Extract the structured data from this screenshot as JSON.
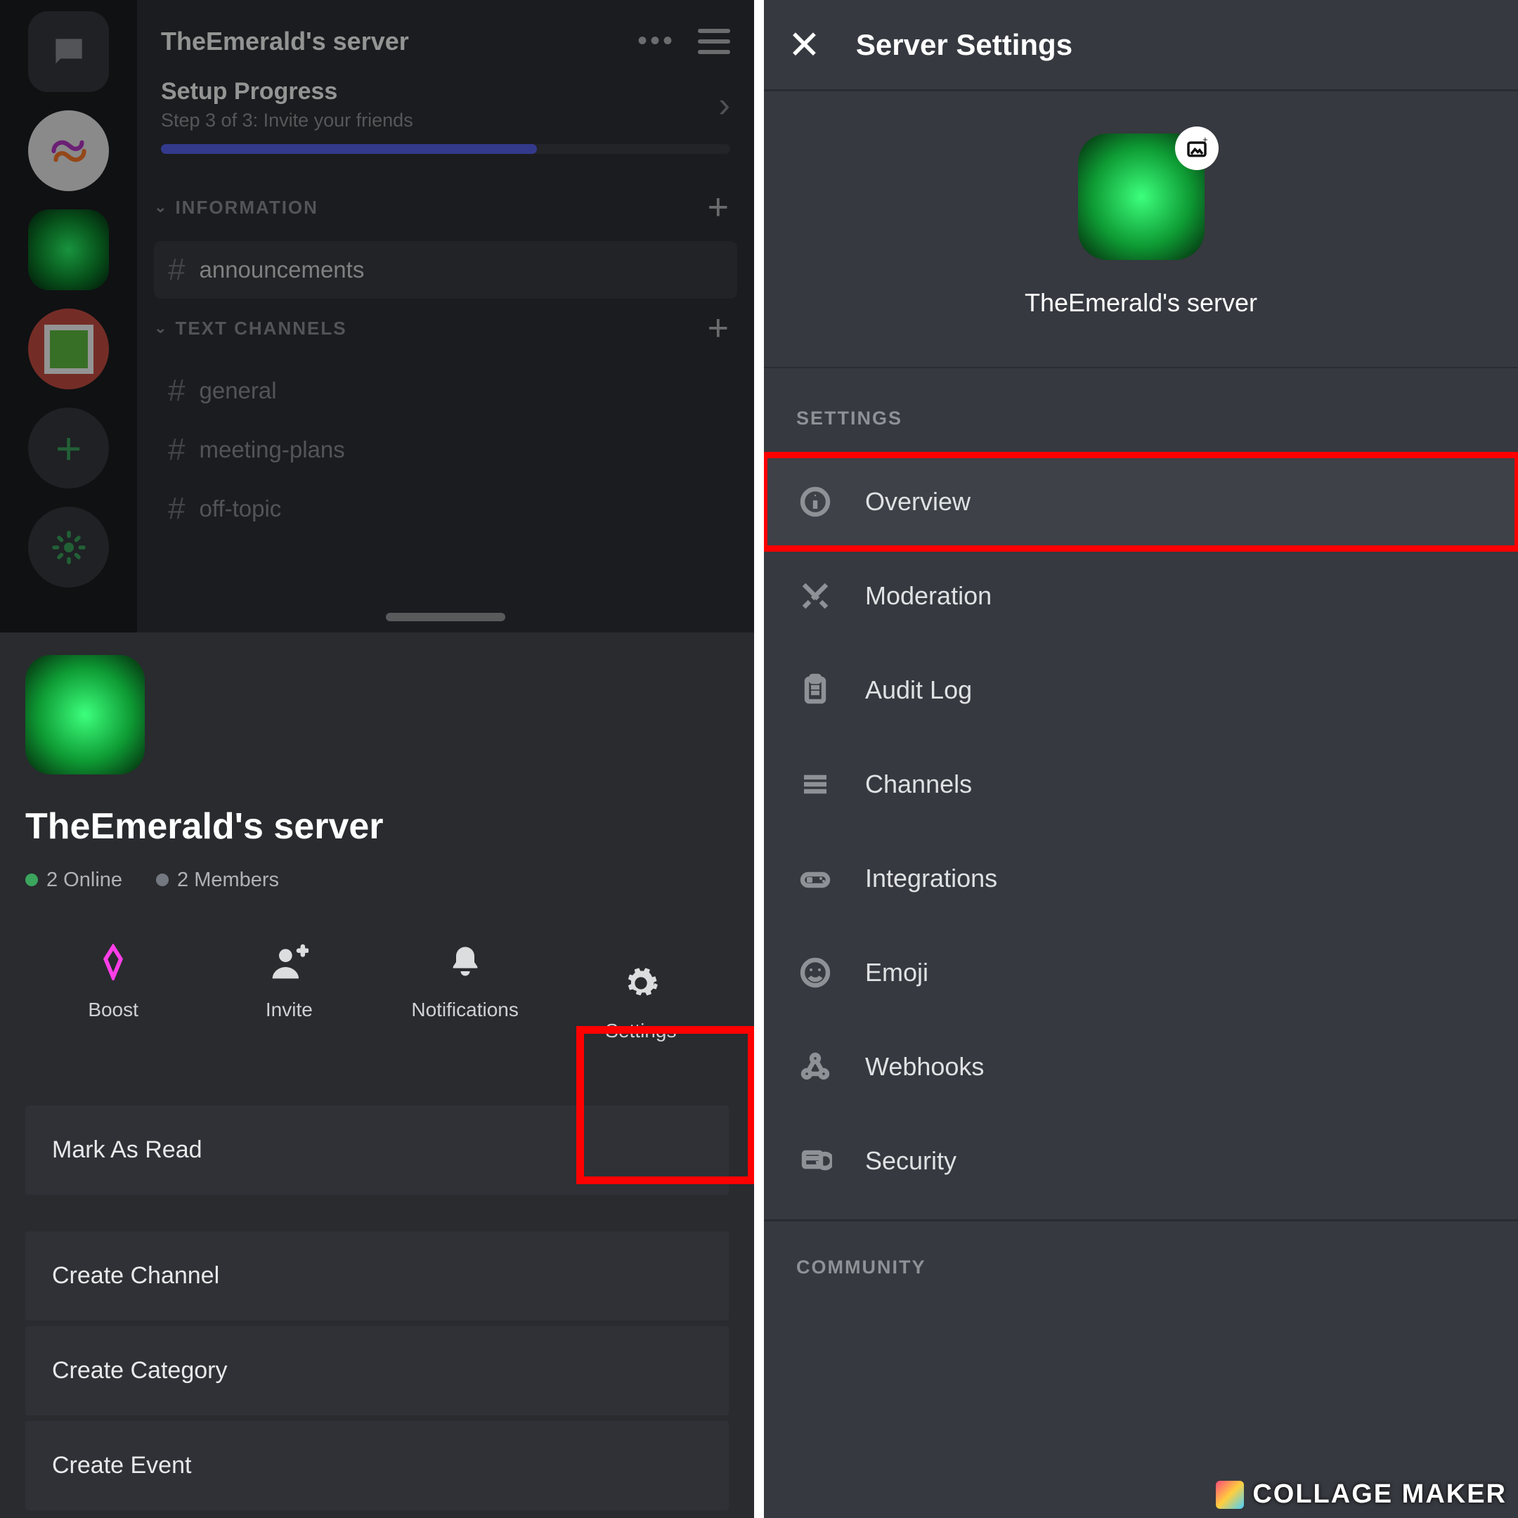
{
  "left": {
    "server_title": "TheEmerald's server",
    "setup": {
      "title": "Setup Progress",
      "subtitle": "Step 3 of 3: Invite your friends",
      "progress_pct": 66
    },
    "categories": {
      "information": "INFORMATION",
      "text_channels": "TEXT CHANNELS"
    },
    "channels": {
      "announcements": "announcements",
      "general": "general",
      "meeting_plans": "meeting-plans",
      "off_topic": "off-topic"
    },
    "sheet": {
      "server_name": "TheEmerald's server",
      "online_count": "2 Online",
      "member_count": "2 Members",
      "actions": {
        "boost": "Boost",
        "invite": "Invite",
        "notifications": "Notifications",
        "settings": "Settings"
      },
      "menu": {
        "mark_read": "Mark As Read",
        "create_channel": "Create Channel",
        "create_category": "Create Category",
        "create_event": "Create Event"
      }
    }
  },
  "right": {
    "title": "Server Settings",
    "server_name": "TheEmerald's server",
    "sections": {
      "settings": "SETTINGS",
      "community": "COMMUNITY"
    },
    "items": {
      "overview": "Overview",
      "moderation": "Moderation",
      "audit_log": "Audit Log",
      "channels": "Channels",
      "integrations": "Integrations",
      "emoji": "Emoji",
      "webhooks": "Webhooks",
      "security": "Security"
    }
  },
  "watermark": "COLLAGE MAKER"
}
